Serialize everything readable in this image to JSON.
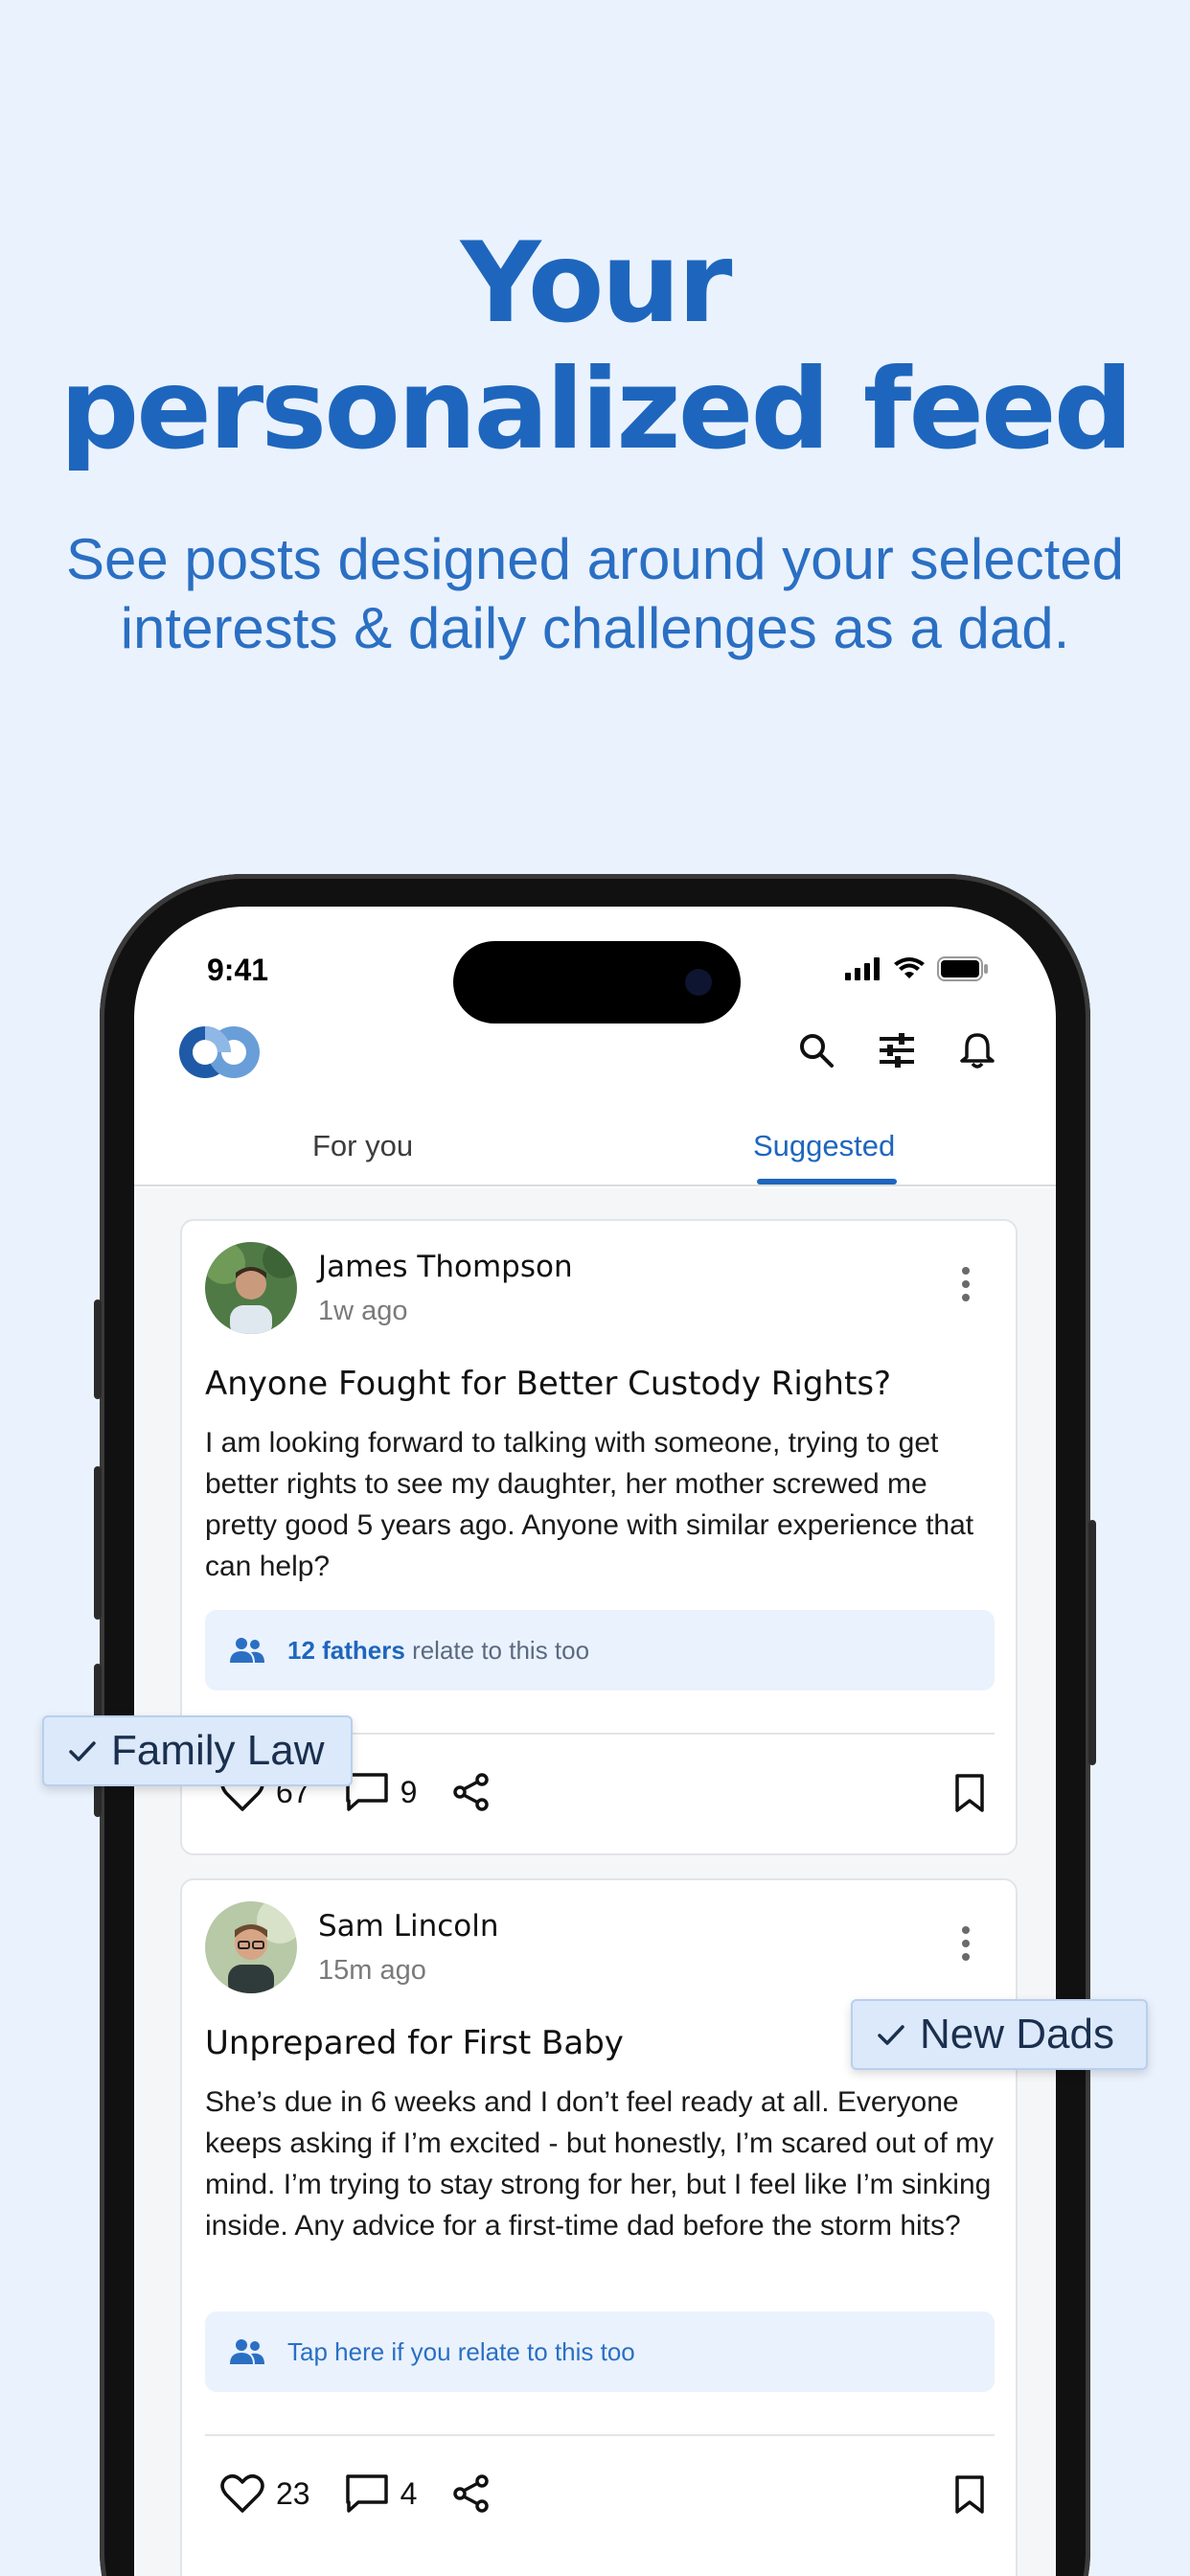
{
  "promo": {
    "headline_line1": "Your",
    "headline_line2": "personalized feed",
    "subline": "See posts designed around your selected interests & daily challenges as a dad."
  },
  "status_bar": {
    "time": "9:41"
  },
  "app_bar": {
    "icons": [
      "app-logo",
      "search-icon",
      "filter-sliders-icon",
      "bell-icon"
    ]
  },
  "tabs": [
    {
      "label": "For you",
      "active": false
    },
    {
      "label": "Suggested",
      "active": true
    }
  ],
  "posts": [
    {
      "author": "James Thompson",
      "ago": "1w ago",
      "title": "Anyone Fought for Better Custody Rights?",
      "body": "I am looking forward to talking with someone, trying to get better rights to see my daughter, her mother screwed me pretty good 5 years ago. Anyone with similar experience that can help?",
      "relate_count": "12 fathers",
      "relate_suffix": " relate to this too",
      "likes": "67",
      "comments": "9"
    },
    {
      "author": "Sam Lincoln",
      "ago": "15m ago",
      "title": "Unprepared for First Baby",
      "body": "She’s due in 6 weeks and I don’t feel ready at all. Everyone keeps asking if I’m excited - but honestly, I’m scared out of my mind. I’m trying to stay strong for her, but I feel like I’m sinking inside. Any advice for a first-time dad before the storm hits?",
      "relate_prompt": "Tap here if you relate to this too",
      "likes": "23",
      "comments": "4"
    }
  ],
  "chips": [
    {
      "label": "Family Law"
    },
    {
      "label": "New Dads"
    }
  ],
  "colors": {
    "background": "#eaf2fd",
    "brand_blue": "#1e66bd",
    "relate_bg": "#eaf2fd",
    "chip_bg": "#dbe9fa"
  }
}
